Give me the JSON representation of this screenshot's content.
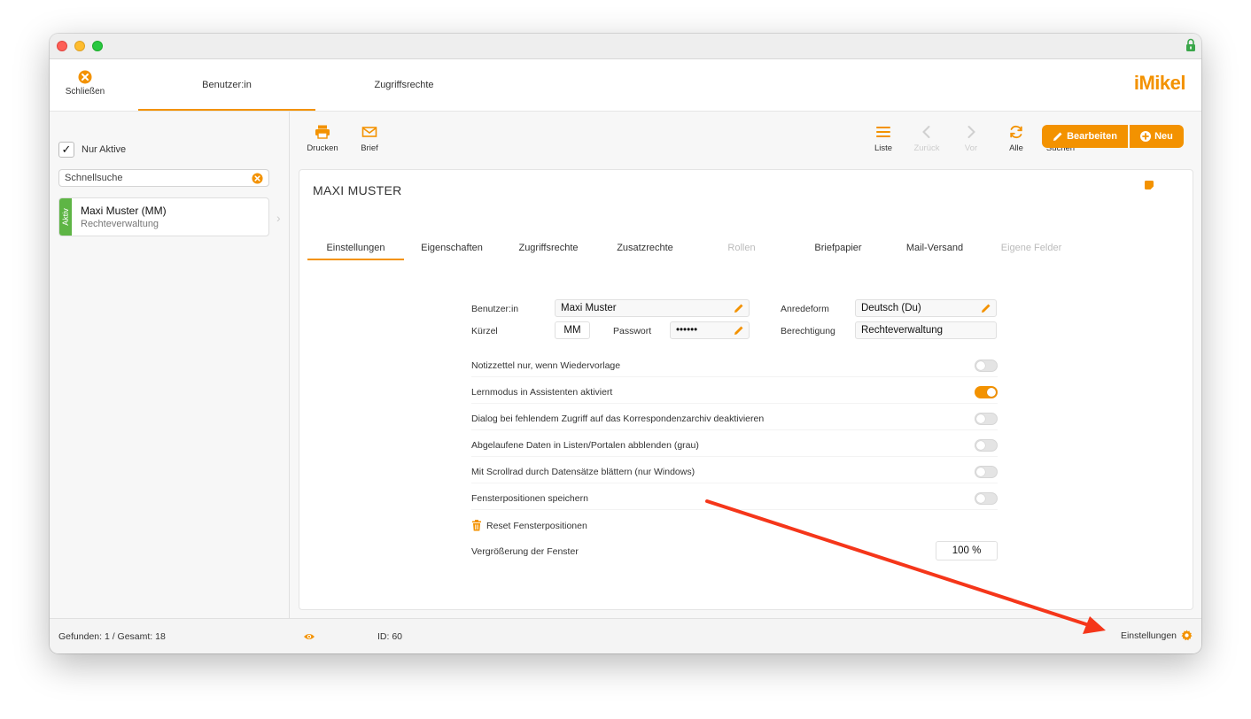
{
  "window": {
    "title": ""
  },
  "topbar": {
    "close_label": "Schließen",
    "tabs": [
      {
        "label": "Benutzer:in",
        "active": true
      },
      {
        "label": "Zugriffsrechte",
        "active": false
      }
    ],
    "logo_text": "iMikel"
  },
  "sidebar": {
    "filter_checkbox": {
      "label": "Nur Aktive",
      "checked": true
    },
    "quicksearch": {
      "value": "Schnellsuche"
    },
    "records": [
      {
        "status": "Aktiv",
        "name": "Maxi Muster (MM)",
        "role": "Rechteverwaltung"
      }
    ]
  },
  "toolbar": {
    "left": [
      {
        "label": "Drucken",
        "icon": "printer-icon"
      },
      {
        "label": "Brief",
        "icon": "envelope-icon"
      }
    ],
    "right": [
      {
        "label": "Liste",
        "icon": "list-icon",
        "enabled": true
      },
      {
        "label": "Zurück",
        "icon": "chevron-left-icon",
        "enabled": false
      },
      {
        "label": "Vor",
        "icon": "chevron-right-icon",
        "enabled": false
      },
      {
        "label": "Alle",
        "icon": "refresh-icon",
        "enabled": true
      },
      {
        "label": "Suchen",
        "icon": "search-icon",
        "enabled": true
      }
    ],
    "edit_button": "Bearbeiten",
    "new_button": "Neu"
  },
  "record": {
    "title": "MAXI MUSTER",
    "subtabs": [
      {
        "label": "Einstellungen",
        "active": true,
        "enabled": true
      },
      {
        "label": "Eigenschaften",
        "active": false,
        "enabled": true
      },
      {
        "label": "Zugriffsrechte",
        "active": false,
        "enabled": true
      },
      {
        "label": "Zusatzrechte",
        "active": false,
        "enabled": true
      },
      {
        "label": "Rollen",
        "active": false,
        "enabled": false
      },
      {
        "label": "Briefpapier",
        "active": false,
        "enabled": true
      },
      {
        "label": "Mail-Versand",
        "active": false,
        "enabled": true
      },
      {
        "label": "Eigene Felder",
        "active": false,
        "enabled": false
      }
    ]
  },
  "form": {
    "user_label": "Benutzer:in",
    "user_value": "Maxi Muster",
    "salutation_label": "Anredeform",
    "salutation_value": "Deutsch (Du)",
    "short_label": "Kürzel",
    "short_value": "MM",
    "password_label": "Passwort",
    "password_value": "••••••",
    "permission_label": "Berechtigung",
    "permission_value": "Rechteverwaltung",
    "settings": [
      {
        "label": "Notizzettel nur, wenn Wiedervorlage",
        "on": false
      },
      {
        "label": "Lernmodus in Assistenten aktiviert",
        "on": true
      },
      {
        "label": "Dialog bei fehlendem Zugriff auf das Korrespondenzarchiv deaktivieren",
        "on": false
      },
      {
        "label": "Abgelaufene Daten in Listen/Portalen abblenden (grau)",
        "on": false
      },
      {
        "label": "Mit Scrollrad durch Datensätze blättern (nur Windows)",
        "on": false
      },
      {
        "label": "Fensterpositionen speichern",
        "on": false
      }
    ],
    "reset_label": "Reset Fensterpositionen",
    "zoom_label": "Vergrößerung der Fenster",
    "zoom_value": "100 %"
  },
  "statusbar": {
    "found": "Gefunden: 1 / Gesamt: 18",
    "id": "ID: 60",
    "settings_label": "Einstellungen"
  },
  "colors": {
    "accent": "#f39200",
    "active_status": "#5eb545",
    "annotation_arrow": "#f5361a"
  }
}
